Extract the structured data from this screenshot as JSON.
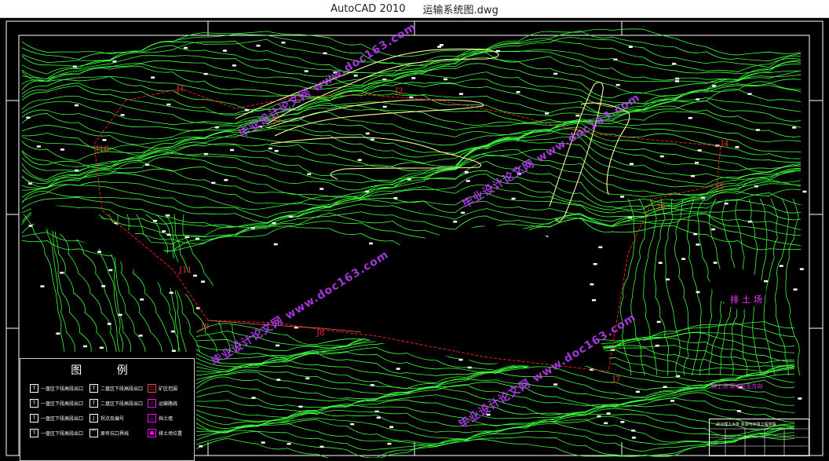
{
  "window": {
    "app_title": "AutoCAD 2010",
    "file_name": "运输系统图.dwg"
  },
  "legend": {
    "title": "图    例",
    "items": [
      {
        "label": "一盘区下段高段出口",
        "icon": "stope-symbol"
      },
      {
        "label": "一盘区下段高段出口",
        "icon": "stope-symbol"
      },
      {
        "label": "一盘区下段高段出口",
        "icon": "stope-symbol"
      },
      {
        "label": "一盘区下段高段出口",
        "icon": "stope-symbol"
      },
      {
        "label": "二盘区下段高段出口",
        "icon": "stope-symbol"
      },
      {
        "label": "二盘区下段高段出口",
        "icon": "stope-symbol"
      },
      {
        "label": "拐点及编号",
        "icon": "turn-point-symbol"
      },
      {
        "label": "原有坑口界线",
        "icon": "pit-boundary-symbol"
      },
      {
        "label": "矿区范围",
        "icon": "mining-area-symbol"
      },
      {
        "label": "运输路线",
        "icon": "road-symbol"
      },
      {
        "label": "挡土墙",
        "icon": "triangle-symbol"
      },
      {
        "label": "排土场位置",
        "icon": "dump-symbol"
      }
    ]
  },
  "map_labels": {
    "turn_points": [
      "J1",
      "J2",
      "J3",
      "J4",
      "J5",
      "J6",
      "J7",
      "J8",
      "J9",
      "J10",
      "J11"
    ],
    "dump_label": "排土场",
    "note": "排土场 原地形至方向"
  },
  "title_block": {
    "school": "武汉理工大学 资源与环境工程学院"
  },
  "watermarks": [
    "毕业设计论文网 www.doc163.com"
  ],
  "colors": {
    "contour": "#3cff3c",
    "boundary": "#ff2020",
    "road": "#ffffa0",
    "label_magenta": "#ff33ff"
  }
}
